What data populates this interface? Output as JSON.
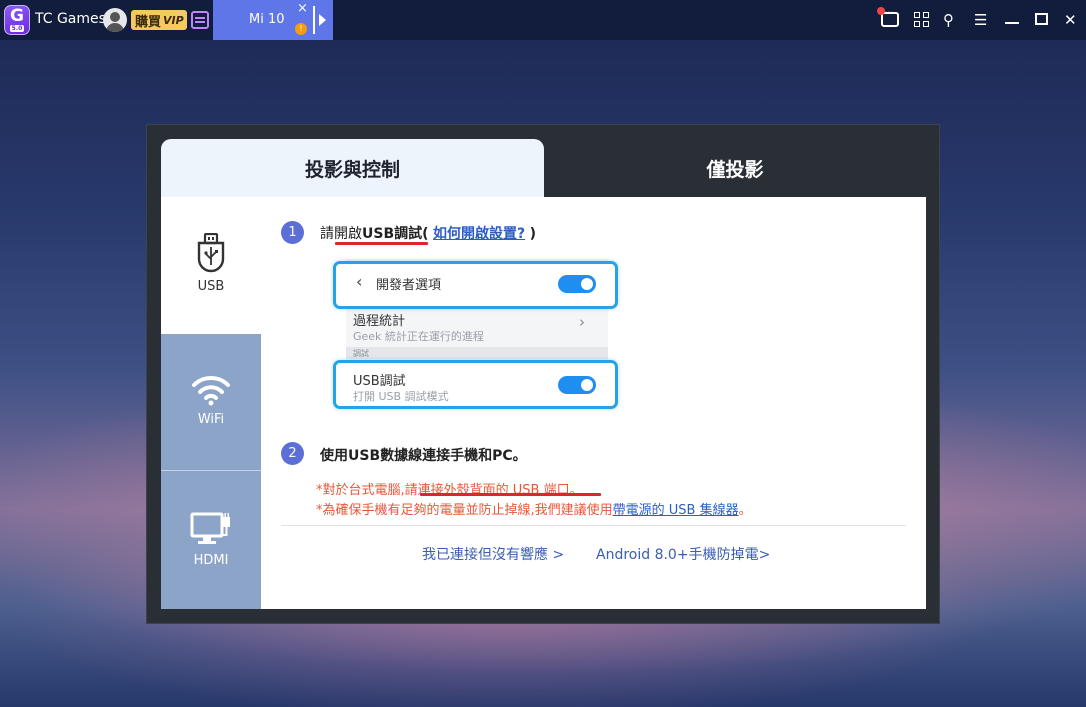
{
  "app": {
    "name": "TC Games",
    "logo_letter": "G",
    "logo_version": "5.0",
    "vip_label": "購買",
    "vip_badge": "VIP"
  },
  "device_tab": {
    "name": "Mi 10",
    "close": "×",
    "warn": "!"
  },
  "window_controls": [
    "message-icon",
    "grid-icon",
    "pin-icon",
    "menu-icon",
    "minimize-icon",
    "maximize-icon",
    "close-icon"
  ],
  "window_glyphs": {
    "pin": "⚲",
    "menu": "☰",
    "close": "✕"
  },
  "tabs": {
    "active": "投影與控制",
    "inactive": "僅投影"
  },
  "sidebar": [
    {
      "label": "USB",
      "icon": "usb-icon",
      "selected": true
    },
    {
      "label": "WiFi",
      "icon": "wifi-icon",
      "selected": false
    },
    {
      "label": "HDMI",
      "icon": "hdmi-icon",
      "selected": false
    }
  ],
  "step1": {
    "num": "1",
    "prefix": "請",
    "underlined": "開啟",
    "bold": "USB調試",
    "paren_open": "(",
    "link": "如何開啟設置?",
    "paren_close": ")"
  },
  "mock_settings": {
    "row1_title": "開發者選項",
    "row1_chevron": "‹",
    "row2_title": "過程統計",
    "row2_sub": "Geek 統計正在運行的進程",
    "row2_chevron": "›",
    "section_header": "調試",
    "row3_title": "USB調試",
    "row3_sub": "打開 USB 調試模式"
  },
  "step2": {
    "num": "2",
    "text": "使用USB數據線連接手機和PC。"
  },
  "notes": {
    "line1_prefix": "*對於台式電腦,",
    "line1_underlined": "請連接外殼背面的 USB 端口。",
    "line2_prefix": "*為確保手機有足夠的電量並防止掉線,我們建議使用",
    "line2_link": "帶電源的 USB 集線器",
    "line2_suffix": "。"
  },
  "footer": {
    "link1": "我已連接但沒有響應 >",
    "link2": "Android 8.0+手機防掉電>"
  },
  "colors": {
    "accent": "#5b6fd6",
    "tab_blue": "#5f76e8",
    "toggle": "#1f8ef1",
    "highlight_border": "#27a2e6",
    "note_red": "#e8573a",
    "link_blue": "#2b5fbf",
    "sidebar_inactive": "#8ca4c7"
  }
}
